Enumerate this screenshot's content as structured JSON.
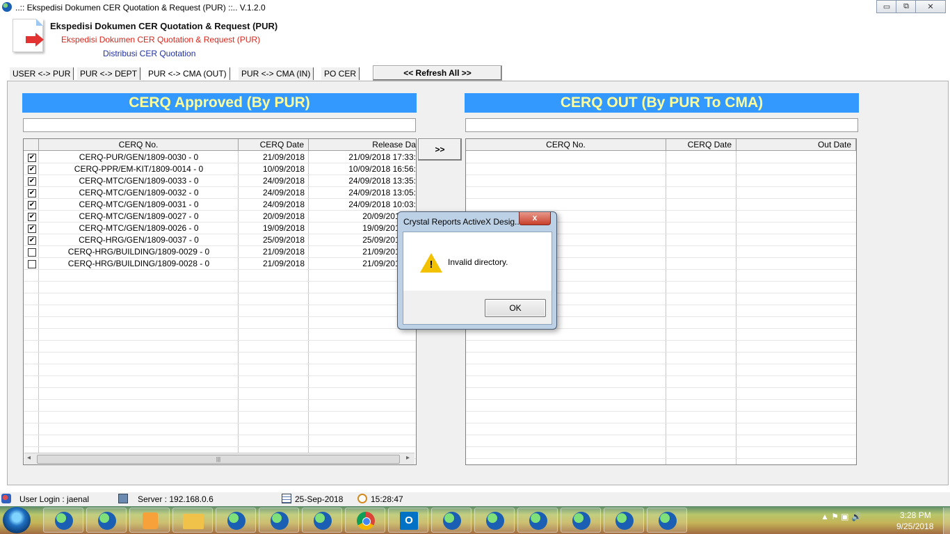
{
  "window": {
    "title": "..:: Ekspedisi Dokumen CER Quotation & Request (PUR) ::.. V.1.2.0",
    "minimize_glyph": "▭",
    "maximize_glyph": "⧉",
    "close_glyph": "✕"
  },
  "header": {
    "line1": "Ekspedisi Dokumen CER Quotation & Request (PUR)",
    "line2": "Ekspedisi Dokumen CER Quotation & Request (PUR)",
    "line3": "Distribusi CER Quotation"
  },
  "tabs": [
    {
      "label": "USER <-> PUR",
      "active": false
    },
    {
      "label": "PUR <-> DEPT",
      "active": false
    },
    {
      "label": "PUR <-> CMA (OUT)",
      "active": true
    },
    {
      "label": "PUR <-> CMA (IN)",
      "active": false
    },
    {
      "label": "PO CER",
      "active": false
    }
  ],
  "refresh_label": "<< Refresh All >>",
  "left_panel": {
    "title": "CERQ Approved (By PUR)",
    "search_value": "",
    "columns": [
      "CERQ No.",
      "CERQ Date",
      "Release Da"
    ],
    "rows": [
      {
        "checked": "✔",
        "no": "CERQ-PUR/GEN/1809-0030 - 0",
        "date": "21/09/2018",
        "release": "21/09/2018 17:33:"
      },
      {
        "checked": "✔",
        "no": "CERQ-PPR/EM-KIT/1809-0014 - 0",
        "date": "10/09/2018",
        "release": "10/09/2018 16:56:"
      },
      {
        "checked": "✔",
        "no": "CERQ-MTC/GEN/1809-0033 - 0",
        "date": "24/09/2018",
        "release": "24/09/2018 13:35:"
      },
      {
        "checked": "✔",
        "no": "CERQ-MTC/GEN/1809-0032 - 0",
        "date": "24/09/2018",
        "release": "24/09/2018 13:05:"
      },
      {
        "checked": "✔",
        "no": "CERQ-MTC/GEN/1809-0031 - 0",
        "date": "24/09/2018",
        "release": "24/09/2018 10:03:"
      },
      {
        "checked": "✔",
        "no": "CERQ-MTC/GEN/1809-0027 - 0",
        "date": "20/09/2018",
        "release": "20/09/2018 09"
      },
      {
        "checked": "✔",
        "no": "CERQ-MTC/GEN/1809-0026 - 0",
        "date": "19/09/2018",
        "release": "19/09/2018 14"
      },
      {
        "checked": "✔",
        "no": "CERQ-HRG/GEN/1809-0037 - 0",
        "date": "25/09/2018",
        "release": "25/09/2018 09"
      },
      {
        "checked": "",
        "no": "CERQ-HRG/BUILDING/1809-0029 - 0",
        "date": "21/09/2018",
        "release": "21/09/2018 17"
      },
      {
        "checked": "",
        "no": "CERQ-HRG/BUILDING/1809-0028 - 0",
        "date": "21/09/2018",
        "release": "21/09/2018 17"
      }
    ],
    "scroll_grip": "|||",
    "scroll_left": "◂",
    "scroll_right": "▸"
  },
  "move_label": ">>",
  "right_panel": {
    "title": "CERQ OUT (By PUR To CMA)",
    "search_value": "",
    "columns": [
      "CERQ No.",
      "CERQ Date",
      "Out Date"
    ]
  },
  "dialog": {
    "title": "Crystal Reports ActiveX Desig...",
    "close_glyph": "x",
    "icon_mark": "!",
    "message": "Invalid directory.",
    "ok_label": "OK"
  },
  "statusbar": {
    "user": "User Login : jaenal",
    "server": "Server : 192.168.0.6",
    "date": "25-Sep-2018",
    "time": "15:28:47"
  },
  "taskbar": {
    "clock_time": "3:28 PM",
    "clock_date": "9/25/2018",
    "tray_glyphs": "▲  ⚑  ▣  🔊",
    "outlook_letter": "O"
  },
  "colors": {
    "panel_header_bg": "#3399ff",
    "panel_header_text": "#ffff99",
    "header_red": "#d8261c",
    "header_blue": "#2030a0"
  }
}
